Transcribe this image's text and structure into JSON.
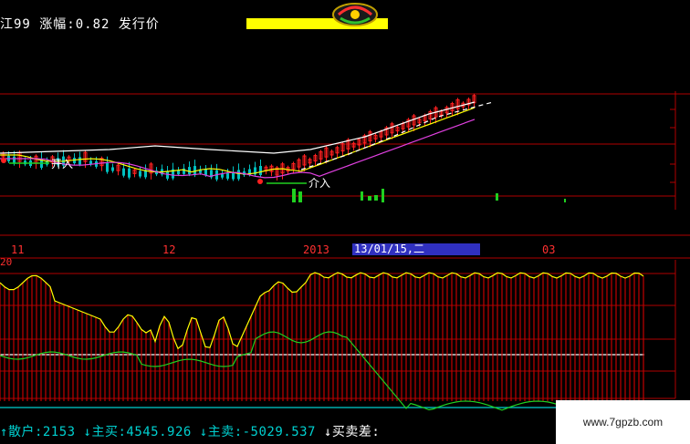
{
  "header": {
    "text": "江99 涨幅:0.82 发行价",
    "logo": "logo-badge"
  },
  "annotations": {
    "left_marker": "开入",
    "mid_marker": "介入"
  },
  "time_axis": {
    "labels": [
      "11",
      "12",
      "2013",
      "03"
    ],
    "selected_date": "13/01/15,二"
  },
  "indicator": {
    "left_label": "20"
  },
  "bottom_bar": {
    "sanhu_arrow": "↑",
    "sanhu_label": "散户",
    "sanhu_value": ":2153",
    "zhumai_arrow": "↓",
    "zhumai_label": "主买",
    "zhumai_value": ":4545.926",
    "zhumai2_arrow": "↓",
    "zhumai2_label": "主卖",
    "zhumai2_value": ":-5029.537",
    "diff_arrow": "↓",
    "diff_label": "买卖差",
    "diff_value": ":"
  },
  "watermark": "www.7gpzb.com",
  "colors": {
    "up": "#ff2020",
    "down": "#00c0c0",
    "white": "#ffffff",
    "yellow": "#ffff00",
    "green": "#20d020",
    "magenta": "#e040e0",
    "background": "#000000"
  }
}
